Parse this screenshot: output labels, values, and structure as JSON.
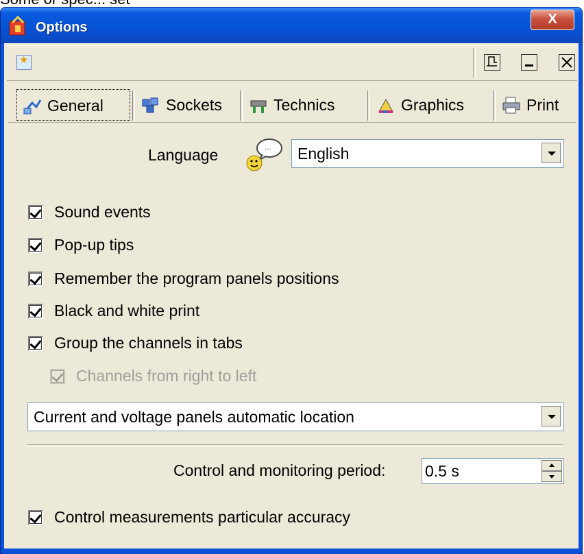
{
  "top_crop_text": "Some or spec... set",
  "window": {
    "title": "Options",
    "close_label": "X",
    "accent": "#0b51d6"
  },
  "toolbar": {
    "left_icon": "star-icon",
    "right_icons": [
      "pin-icon",
      "minimize-icon",
      "close-icon"
    ]
  },
  "tabs": [
    {
      "label": "General",
      "icon": "general-tab-icon",
      "active": true
    },
    {
      "label": "Sockets",
      "icon": "sockets-icon"
    },
    {
      "label": "Technics",
      "icon": "technics-icon"
    },
    {
      "label": "Graphics",
      "icon": "graphics-icon"
    },
    {
      "label": "Print",
      "icon": "printer-icon"
    }
  ],
  "general": {
    "language_label": "Language",
    "language_value": "English",
    "checkboxes": [
      {
        "label": "Sound events",
        "checked": true
      },
      {
        "label": "Pop-up tips",
        "checked": true
      },
      {
        "label": "Remember the program panels positions",
        "checked": true
      },
      {
        "label": "Black and white print",
        "checked": true
      },
      {
        "label": "Group the channels in tabs",
        "checked": true
      },
      {
        "label": "Channels from right to left",
        "checked": true,
        "disabled": true
      }
    ],
    "location_value": "Current and voltage panels automatic location",
    "period_label": "Control and monitoring period:",
    "period_value": "0.5 s",
    "accuracy_label": "Control measurements particular accuracy",
    "accuracy_checked": true
  }
}
